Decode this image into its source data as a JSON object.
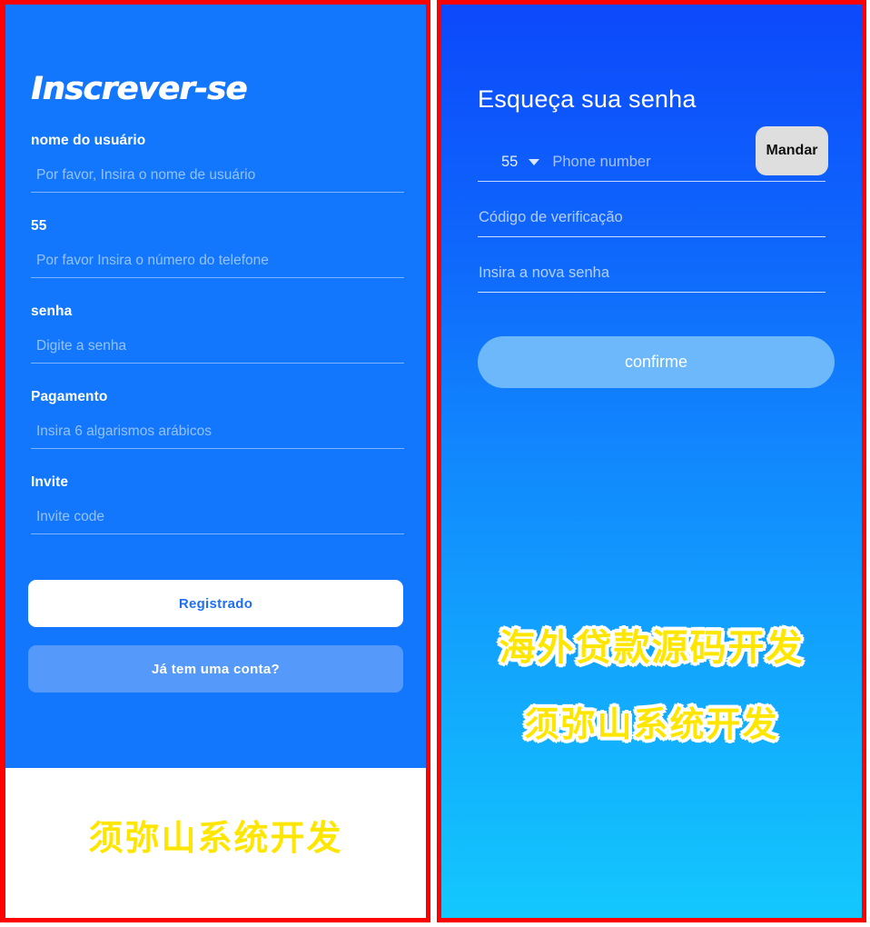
{
  "colors": {
    "frame_border": "#fe0000",
    "left_panel_bg": "#1277fd",
    "right_gradient_top": "#0c49fb",
    "right_gradient_bottom": "#13c8fd",
    "primary_button_bg": "#ffffff",
    "primary_button_text": "#1f6ff5",
    "secondary_button_bg": "#5599fb",
    "send_button_bg": "#dedede",
    "confirm_button_bg": "#6cb8fa",
    "watermark_fill": "#ffe600",
    "watermark_stroke": "#fe0000"
  },
  "signup_screen": {
    "title": "Inscrever-se",
    "fields": [
      {
        "label": "nome do usuário",
        "placeholder": "Por favor, Insira o nome de usuário",
        "value": ""
      },
      {
        "label": "55",
        "placeholder": "Por favor Insira o número do telefone",
        "value": ""
      },
      {
        "label": "senha",
        "placeholder": "Digite a senha",
        "value": ""
      },
      {
        "label": "Pagamento",
        "placeholder": "Insira 6 algarismos arábicos",
        "value": ""
      },
      {
        "label": "Invite",
        "placeholder": "Invite code",
        "value": ""
      }
    ],
    "register_button": "Registrado",
    "have_account_button": "Já tem uma conta?",
    "watermark": "须弥山系统开发"
  },
  "forgot_password_screen": {
    "title": "Esqueça sua senha",
    "country_code": "55",
    "country_code_caret": "chevron-down-icon",
    "phone_placeholder": "Phone number",
    "phone_value": "",
    "send_button": "Mandar",
    "fields": [
      {
        "placeholder": "Código de verificação",
        "value": ""
      },
      {
        "placeholder": "Insira a nova senha",
        "value": ""
      }
    ],
    "confirm_button": "confirme",
    "watermark_lines": [
      "海外贷款源码开发",
      "须弥山系统开发"
    ]
  }
}
